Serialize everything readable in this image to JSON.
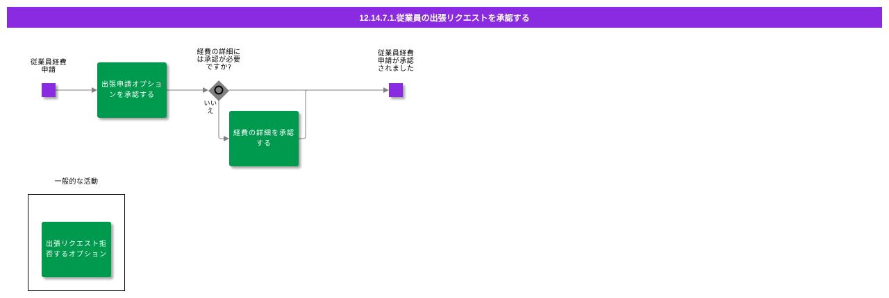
{
  "title": "12.14.7.1.従業員の出張リクエストを承認する",
  "start_event": {
    "label": "従業員経費\n申請"
  },
  "task_approve_trip": {
    "label": "出張申請オプショ\nンを承認する"
  },
  "gateway": {
    "label": "経費の詳細に\nは承認が必要\nですか?",
    "no_label": "いい\nえ"
  },
  "task_approve_expense": {
    "label": "経費の詳細を承認\nする"
  },
  "end_event": {
    "label": "従業員経費\n申請が承認\nされました"
  },
  "group": {
    "label": "一般的な活動"
  },
  "task_reject_trip": {
    "label": "出張リクエスト拒\n否するオプション"
  },
  "colors": {
    "header": "#8a2be2",
    "event": "#8a2be2",
    "task": "#009a4e",
    "gateway": "#808080",
    "connector": "#808080"
  }
}
